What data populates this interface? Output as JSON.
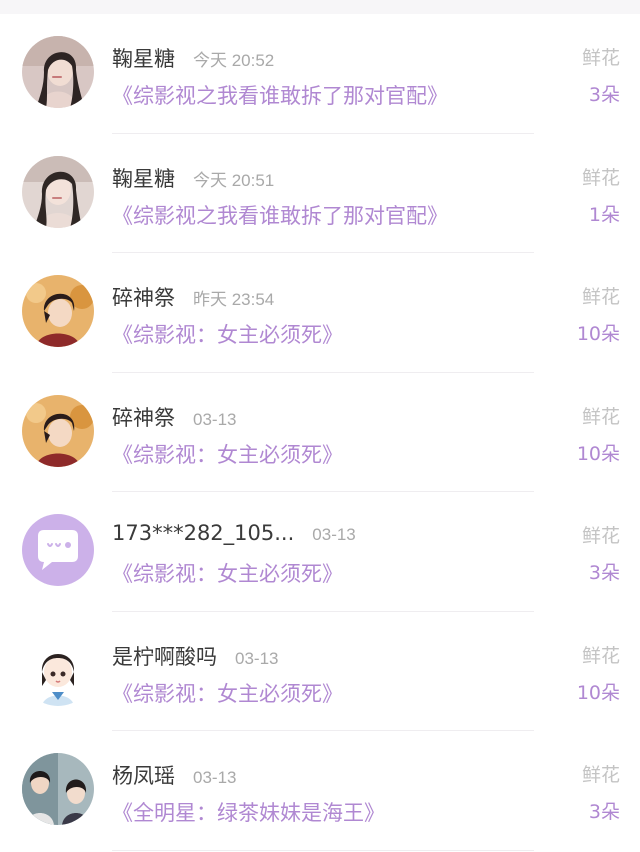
{
  "colors": {
    "accent_purple": "#b088d2",
    "name_text": "#3a3a3a",
    "secondary_text": "#a9a9a9",
    "divider": "#efedf0"
  },
  "records": [
    {
      "name": "鞠星糖",
      "time": "今天 20:52",
      "book": "《综影视之我看谁敢拆了那对官配》",
      "gift": "鲜花",
      "count": "3朵",
      "avatar_icon": "woman-portrait-avatar"
    },
    {
      "name": "鞠星糖",
      "time": "今天 20:51",
      "book": "《综影视之我看谁敢拆了那对官配》",
      "gift": "鲜花",
      "count": "1朵",
      "avatar_icon": "woman-portrait-avatar"
    },
    {
      "name": "碎神祭",
      "time": "昨天 23:54",
      "book": "《综影视：女主必须死》",
      "gift": "鲜花",
      "count": "10朵",
      "avatar_icon": "anime-boy-avatar"
    },
    {
      "name": "碎神祭",
      "time": "03-13",
      "book": "《综影视：女主必须死》",
      "gift": "鲜花",
      "count": "10朵",
      "avatar_icon": "anime-boy-avatar"
    },
    {
      "name": "173***282_105...",
      "time": "03-13",
      "book": "《综影视：女主必须死》",
      "gift": "鲜花",
      "count": "3朵",
      "avatar_icon": "chat-bubble-avatar"
    },
    {
      "name": "是柠啊酸吗",
      "time": "03-13",
      "book": "《综影视：女主必须死》",
      "gift": "鲜花",
      "count": "10朵",
      "avatar_icon": "cartoon-girl-avatar"
    },
    {
      "name": "杨凤瑶",
      "time": "03-13",
      "book": "《全明星：绿茶妹妹是海王》",
      "gift": "鲜花",
      "count": "3朵",
      "avatar_icon": "couple-photo-avatar"
    }
  ]
}
